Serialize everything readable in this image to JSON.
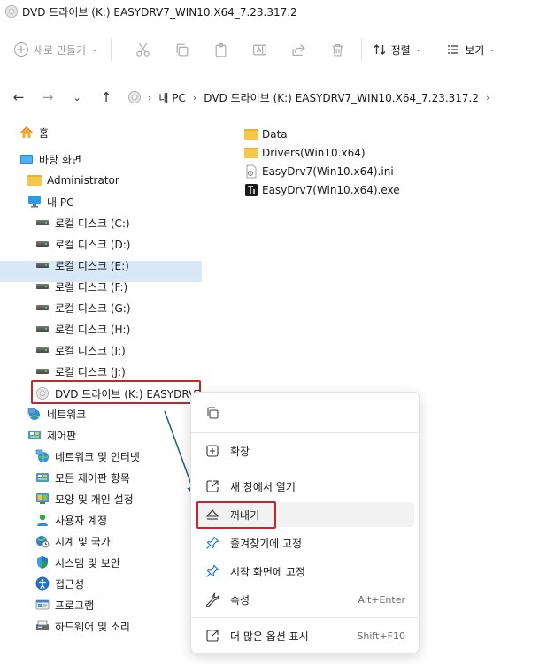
{
  "window": {
    "title": "DVD 드라이브 (K:) EASYDRV7_WIN10.X64_7.23.317.2"
  },
  "toolbar": {
    "new_label": "새로 만들기",
    "sort_label": "정렬",
    "view_label": "보기"
  },
  "address": {
    "crumbs": [
      "내 PC",
      "DVD 드라이브 (K:) EASYDRV7_WIN10.X64_7.23.317.2"
    ]
  },
  "sidebar": {
    "items": [
      {
        "label": "홈",
        "icon": "home-icon"
      },
      {
        "label": "바탕 화면",
        "icon": "desktop-icon"
      },
      {
        "label": "Administrator",
        "icon": "folder-icon"
      },
      {
        "label": "내 PC",
        "icon": "pc-icon"
      },
      {
        "label": "로컬 디스크 (C:)",
        "icon": "drive-icon"
      },
      {
        "label": "로컬 디스크 (D:)",
        "icon": "drive-icon"
      },
      {
        "label": "로컬 디스크 (E:)",
        "icon": "drive-icon"
      },
      {
        "label": "로컬 디스크 (F:)",
        "icon": "drive-icon"
      },
      {
        "label": "로컬 디스크 (G:)",
        "icon": "drive-icon"
      },
      {
        "label": "로컬 디스크 (H:)",
        "icon": "drive-icon"
      },
      {
        "label": "로컬 디스크 (I:)",
        "icon": "drive-icon"
      },
      {
        "label": "로컬 디스크 (J:)",
        "icon": "drive-icon"
      },
      {
        "label": "DVD 드라이브 (K:) EASYDRV7",
        "icon": "dvd-icon"
      },
      {
        "label": "네트워크",
        "icon": "network-icon"
      },
      {
        "label": "제어판",
        "icon": "control-panel-icon"
      },
      {
        "label": "네트워크 및 인터넷",
        "icon": "network-internet-icon"
      },
      {
        "label": "모든 제어판 항목",
        "icon": "all-control-panel-icon"
      },
      {
        "label": "모양 및 개인 설정",
        "icon": "appearance-icon"
      },
      {
        "label": "사용자 계정",
        "icon": "user-accounts-icon"
      },
      {
        "label": "시계 및 국가",
        "icon": "clock-region-icon"
      },
      {
        "label": "시스템 및 보안",
        "icon": "system-security-icon"
      },
      {
        "label": "접근성",
        "icon": "accessibility-icon"
      },
      {
        "label": "프로그램",
        "icon": "programs-icon"
      },
      {
        "label": "하드웨어 및 소리",
        "icon": "hardware-sound-icon"
      }
    ]
  },
  "files": [
    {
      "name": "Data",
      "icon": "folder-icon"
    },
    {
      "name": "Drivers(Win10.x64)",
      "icon": "folder-icon"
    },
    {
      "name": "EasyDrv7(Win10.x64).ini",
      "icon": "ini-file-icon"
    },
    {
      "name": "EasyDrv7(Win10.x64).exe",
      "icon": "exe-file-icon"
    }
  ],
  "context_menu": {
    "expand": "확장",
    "open_new_window": "새 창에서 열기",
    "eject": "꺼내기",
    "pin_favorites": "즐겨찾기에 고정",
    "pin_start": "시작 화면에 고정",
    "properties": "속성",
    "properties_shortcut": "Alt+Enter",
    "more_options": "더 많은 옵션 표시",
    "more_options_shortcut": "Shift+F10"
  },
  "colors": {
    "highlight_box": "#c4262e",
    "arrow": "#1f5f6e",
    "selection": "#d9e8f7",
    "accent": "#0067c0"
  }
}
